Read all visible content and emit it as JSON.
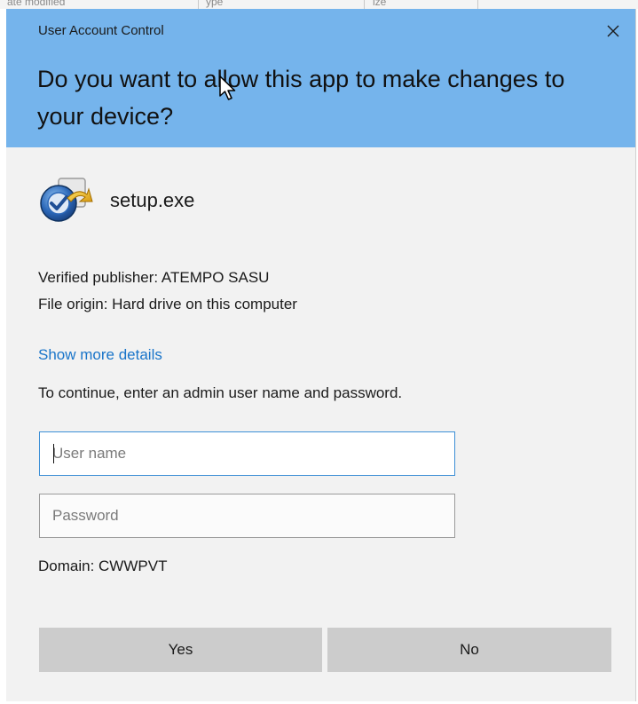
{
  "background_window": {
    "fragments": [
      "ate modified",
      "ype",
      "ize"
    ]
  },
  "dialog": {
    "title": "User Account Control",
    "close_glyph": "✕",
    "headline": "Do you want to allow this app to make changes to your device?",
    "app_name": "setup.exe",
    "app_icon": "setup-program-icon",
    "publisher": "Verified publisher: ATEMPO SASU",
    "origin": "File origin: Hard drive on this computer",
    "details_link": "Show more details",
    "prompt": "To continue, enter an admin user name and password.",
    "username": {
      "value": "",
      "placeholder": "User name"
    },
    "password": {
      "value": "",
      "placeholder": "Password"
    },
    "domain": "Domain: CWWPVT",
    "buttons": {
      "yes": "Yes",
      "no": "No"
    }
  },
  "colors": {
    "header": "#75b4ec",
    "body": "#f2f2f2",
    "link": "#1874c9",
    "focus_border": "#3c8fd6",
    "button": "#cccccc"
  }
}
